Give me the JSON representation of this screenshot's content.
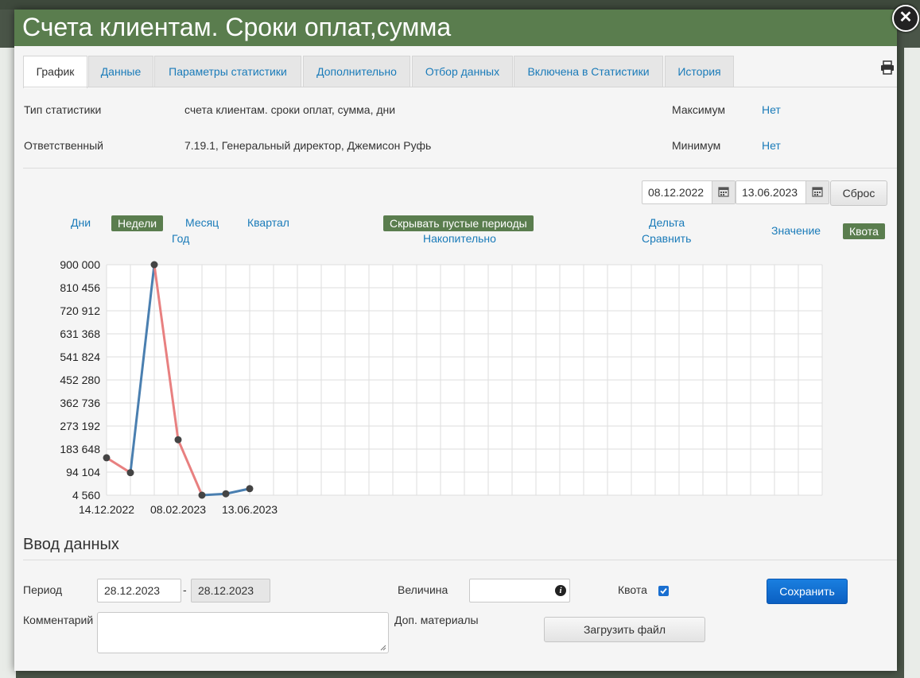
{
  "window": {
    "title": "Счета клиентам. Сроки оплат,сумма",
    "close_glyph": "✕"
  },
  "tabs": [
    {
      "label": "График",
      "active": true
    },
    {
      "label": "Данные"
    },
    {
      "label": "Параметры статистики"
    },
    {
      "label": "Дополнительно"
    },
    {
      "label": "Отбор данных"
    },
    {
      "label": "Включена в Статистики"
    },
    {
      "label": "История"
    }
  ],
  "info": {
    "type_label": "Тип статистики",
    "type_value": "счета клиентам. сроки оплат, сумма, дни",
    "owner_label": "Ответственный",
    "owner_value": "7.19.1, Генеральный директор, Джемисон Руфь",
    "max_label": "Максимум",
    "max_value": "Нет",
    "min_label": "Минимум",
    "min_value": "Нет"
  },
  "daterange": {
    "from": "08.12.2022",
    "to": "13.06.2023",
    "reset_label": "Сброс"
  },
  "controls": {
    "days": "Дни",
    "weeks": "Недели",
    "month": "Месяц",
    "quarter": "Квартал",
    "year": "Год",
    "hide_empty": "Скрывать пустые периоды",
    "cumulative": "Накопительно",
    "delta": "Дельта",
    "compare": "Сравнить",
    "value": "Значение",
    "quota": "Квота"
  },
  "chart_data": {
    "type": "line",
    "ytick_labels": [
      "900 000",
      "810 456",
      "720 912",
      "631 368",
      "541 824",
      "452 280",
      "362 736",
      "273 192",
      "183 648",
      "94 104",
      "4 560"
    ],
    "ylim": [
      4560,
      900000
    ],
    "xtick_labels": [
      "14.12.2022",
      "08.02.2023",
      "13.06.2023"
    ],
    "points": [
      {
        "x_index": 0,
        "y": 150000
      },
      {
        "x_index": 1,
        "y": 92000
      },
      {
        "x_index": 2,
        "y": 900000
      },
      {
        "x_index": 3,
        "y": 220000
      },
      {
        "x_index": 4,
        "y": 4560
      },
      {
        "x_index": 5,
        "y": 10000
      },
      {
        "x_index": 6,
        "y": 30000
      }
    ],
    "segment_colors": [
      "#e88080",
      "#4a7fb0",
      "#e88080",
      "#e88080",
      "#4a7fb0",
      "#4a7fb0"
    ],
    "grid": true
  },
  "entry": {
    "section_title": "Ввод данных",
    "period_label": "Период",
    "period_from": "28.12.2023",
    "period_sep": "-",
    "period_to": "28.12.2023",
    "value_label": "Величина",
    "quota_label": "Квота",
    "save_label": "Сохранить",
    "comment_label": "Комментарий",
    "materials_label": "Доп. материалы",
    "upload_label": "Загрузить файл"
  }
}
